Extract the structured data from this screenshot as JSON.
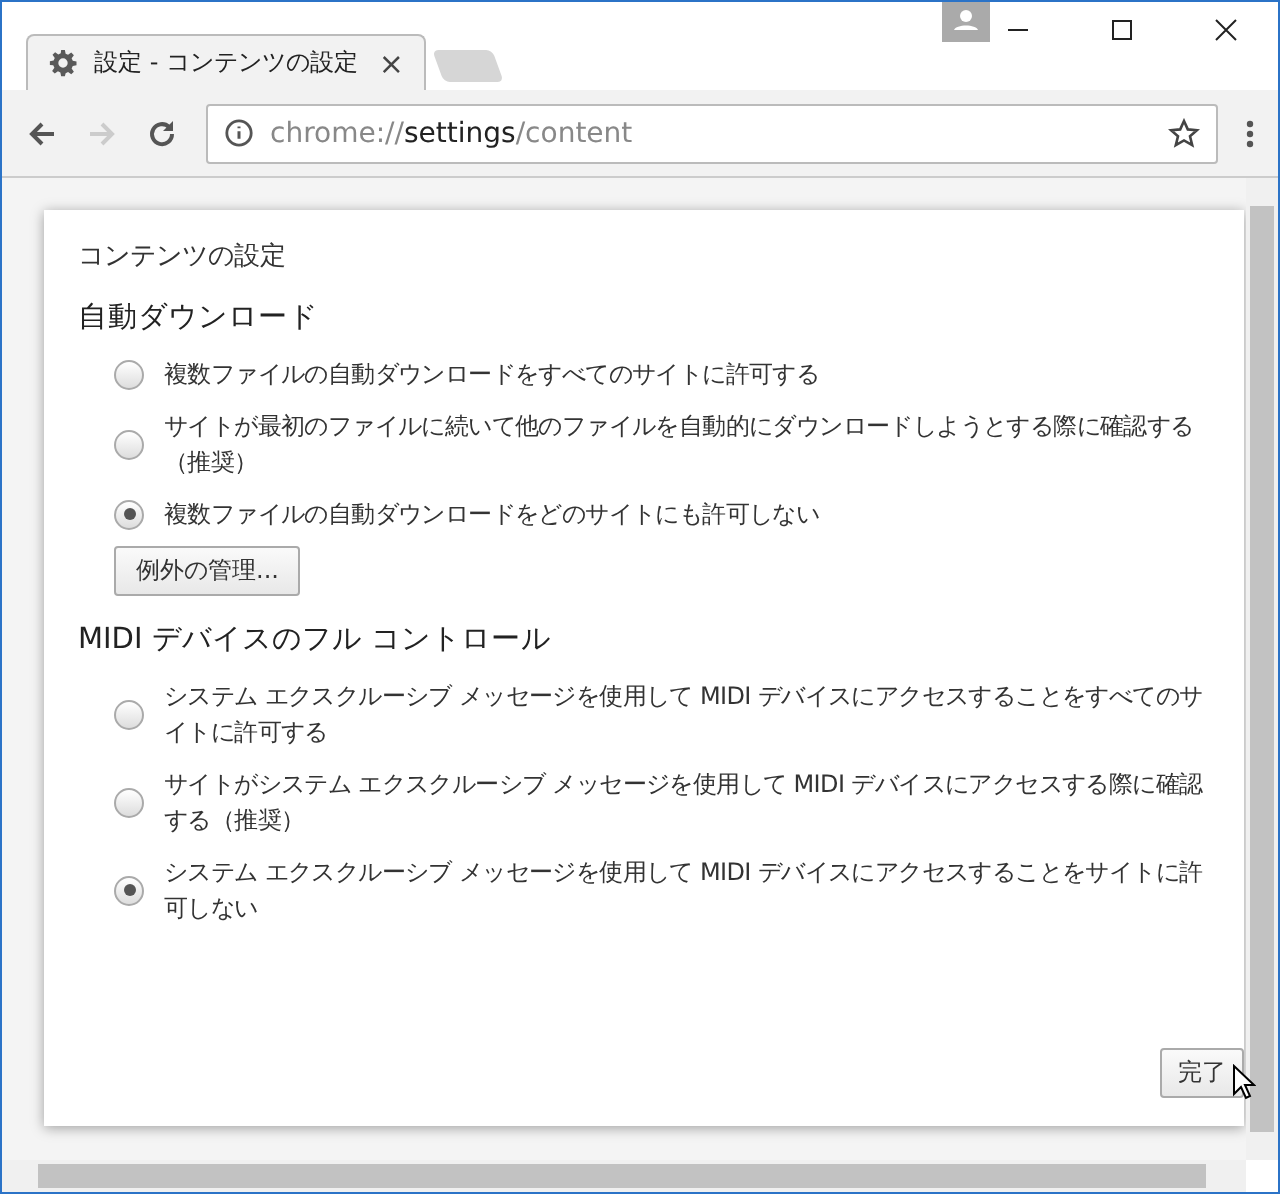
{
  "tab": {
    "title": "設定 - コンテンツの設定",
    "close": "×"
  },
  "address_bar": {
    "scheme": "chrome://",
    "host": "settings",
    "path": "/content"
  },
  "dialog": {
    "title": "コンテンツの設定",
    "sections": [
      {
        "heading": "自動ダウンロード",
        "options": [
          {
            "label": "複数ファイルの自動ダウンロードをすべてのサイトに許可する",
            "selected": false
          },
          {
            "label": "サイトが最初のファイルに続いて他のファイルを自動的にダウンロードしようとする際に確認する（推奨）",
            "selected": false
          },
          {
            "label": "複数ファイルの自動ダウンロードをどのサイトにも許可しない",
            "selected": true
          }
        ],
        "button": "例外の管理..."
      },
      {
        "heading": "MIDI デバイスのフル コントロール",
        "options": [
          {
            "label": "システム エクスクルーシブ メッセージを使用して MIDI デバイスにアクセスすることをすべてのサイトに許可する",
            "selected": false
          },
          {
            "label": "サイトがシステム エクスクルーシブ メッセージを使用して MIDI デバイスにアクセスする際に確認する（推奨）",
            "selected": false
          },
          {
            "label": "システム エクスクルーシブ メッセージを使用して MIDI デバイスにアクセスすることをサイトに許可しない",
            "selected": true
          }
        ]
      }
    ],
    "done_button": "完了"
  }
}
